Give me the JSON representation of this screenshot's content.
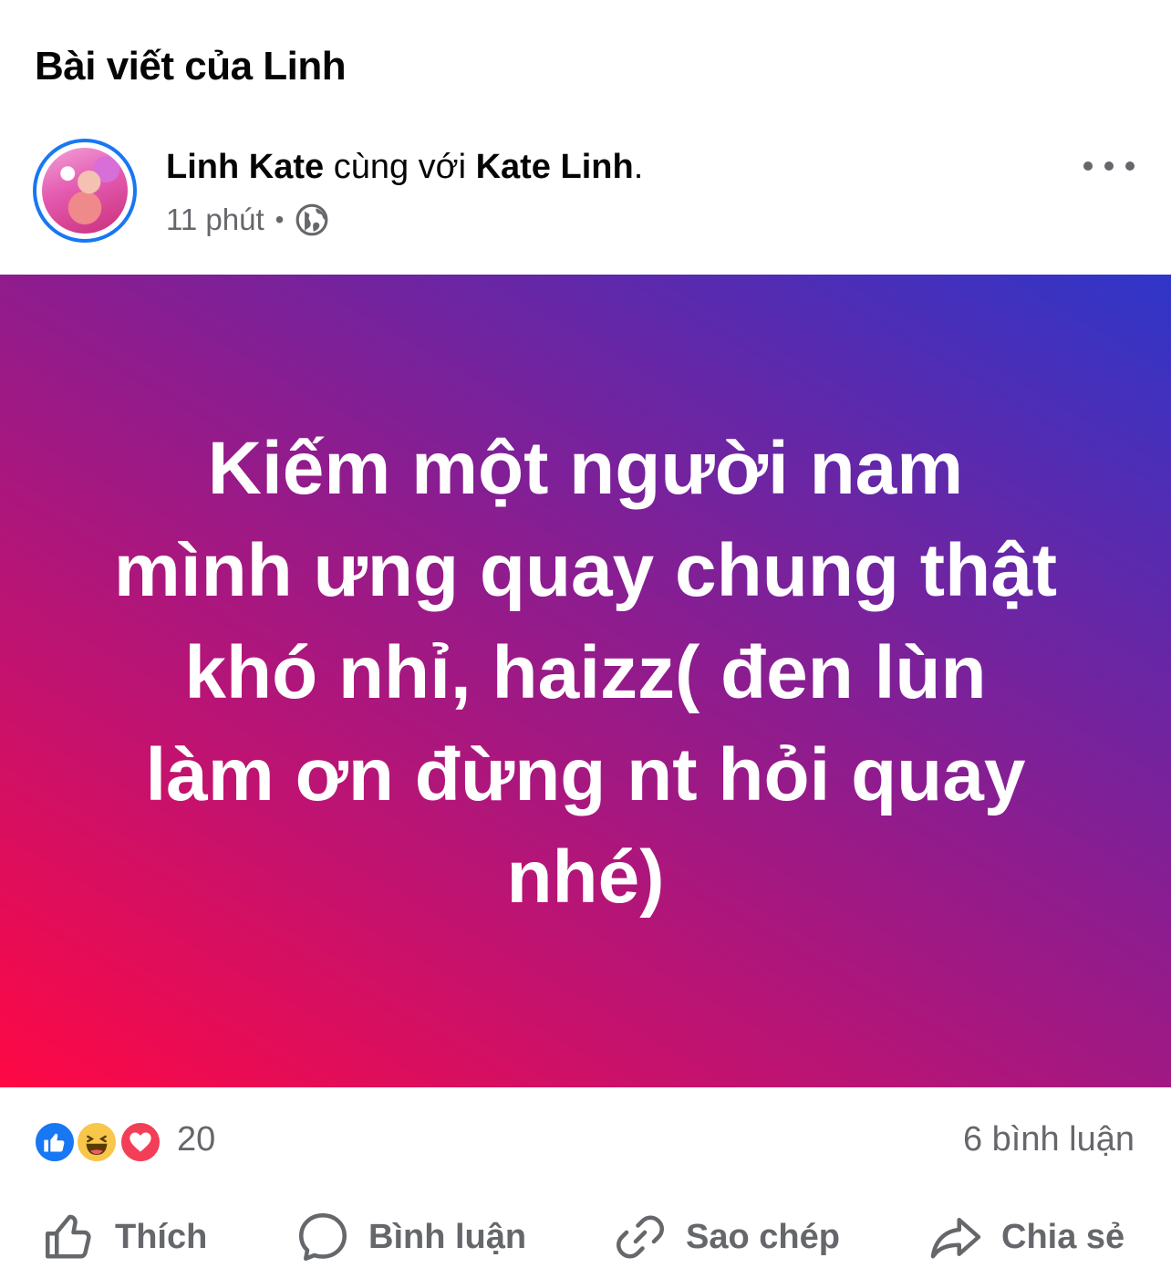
{
  "header": {
    "title": "Bài viết của Linh"
  },
  "post": {
    "author": "Linh Kate",
    "with_text": "cùng với",
    "tagged": "Kate Linh",
    "period": ".",
    "time": "11 phút",
    "separator": "•",
    "privacy_icon": "globe-icon",
    "more_icon": "more-options-icon",
    "background_text": "Kiếm một người nam mình ưng quay chung thật khó nhỉ, haizz( đen lùn làm ơn đừng nt hỏi quay nhé)",
    "background_colors": [
      "#ff0844",
      "#c4126e",
      "#8e1c8e",
      "#5a2aae",
      "#2f36c9"
    ]
  },
  "stats": {
    "reaction_icons": [
      "like-icon",
      "haha-icon",
      "love-icon"
    ],
    "reaction_count": "20",
    "comment_count": "6 bình luận"
  },
  "actions": [
    {
      "label": "Thích",
      "icon": "thumbs-up-icon"
    },
    {
      "label": "Bình luận",
      "icon": "comment-icon"
    },
    {
      "label": "Sao chép",
      "icon": "link-icon"
    },
    {
      "label": "Chia sẻ",
      "icon": "share-icon"
    }
  ],
  "colors": {
    "accent": "#1877f2",
    "secondary_text": "#65676b"
  }
}
